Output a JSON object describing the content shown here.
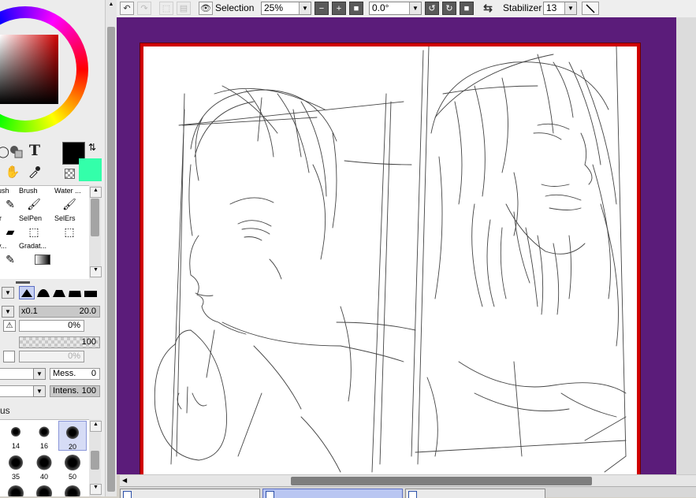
{
  "toolbar": {
    "selection_label": "Selection",
    "zoom_value": "25%",
    "rotation_value": "0.0°",
    "stabilizer_label": "Stabilizer",
    "stabilizer_value": "13"
  },
  "colors": {
    "primary": "#000000",
    "secondary": "#33ffaa",
    "canvas_background": "#5b1c7a",
    "paper_border": "#d00000"
  },
  "tools": {
    "text_tool_glyph": "T"
  },
  "brushes": [
    {
      "label": "rush"
    },
    {
      "label": "Brush"
    },
    {
      "label": "Water ..."
    },
    {
      "label": "er"
    },
    {
      "label": "SelPen"
    },
    {
      "label": "SelErs"
    },
    {
      "label": "ry..."
    },
    {
      "label": "Gradat..."
    }
  ],
  "brush_settings": {
    "size_multiplier": "x0.1",
    "size_value": "20.0",
    "min_size_value": "0%",
    "density_value": "100",
    "disabled_value": "0%",
    "mess_label": "Mess.",
    "mess_value": "0",
    "intens_label": "Intens.",
    "intens_value": "100",
    "section_label": "us"
  },
  "brush_sizes": [
    "14",
    "16",
    "20",
    "35",
    "40",
    "50"
  ],
  "selected_brush_size": "20"
}
